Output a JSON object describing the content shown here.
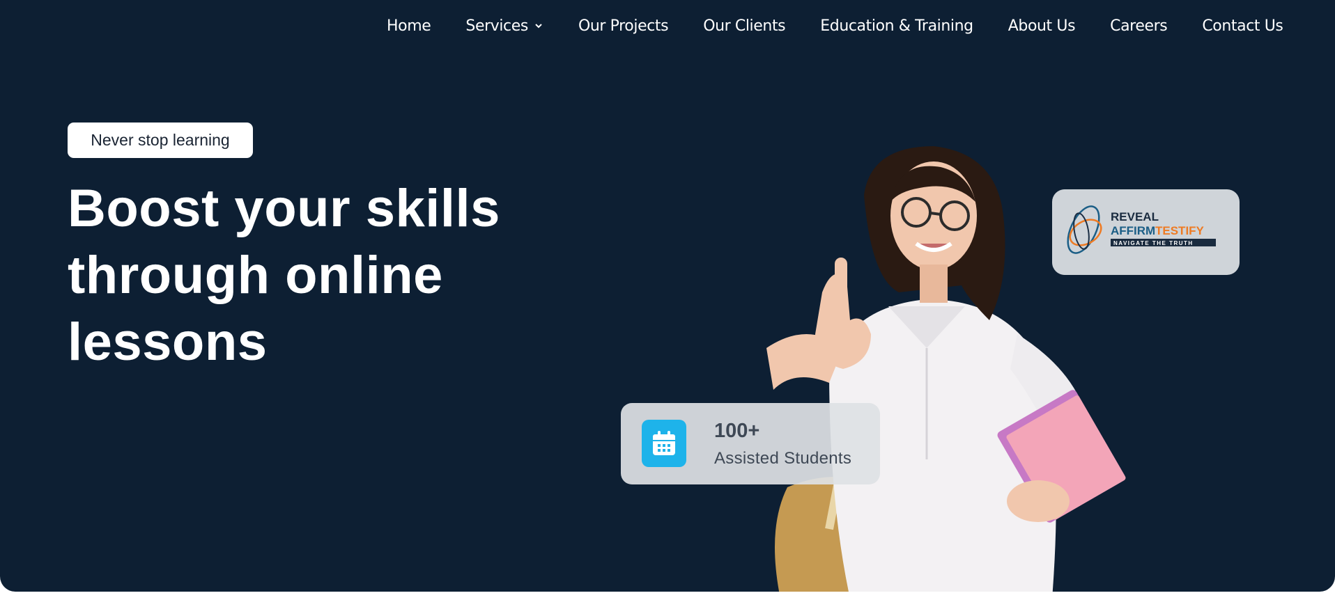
{
  "nav": {
    "items": [
      {
        "label": "Home"
      },
      {
        "label": "Services",
        "has_dropdown": true
      },
      {
        "label": "Our Projects"
      },
      {
        "label": "Our Clients"
      },
      {
        "label": "Education & Training"
      },
      {
        "label": "About Us"
      },
      {
        "label": "Careers"
      },
      {
        "label": "Contact Us"
      }
    ]
  },
  "hero": {
    "tagline": "Never stop learning",
    "headline_lines": [
      "Boost your skills",
      "through online",
      "lessons"
    ]
  },
  "logo_card": {
    "line1": "REVEAL",
    "line2a": "AFFIRM",
    "line2b": "TESTIFY",
    "line3": "NAVIGATE THE TRUTH"
  },
  "stats": {
    "value": "100+",
    "label": "Assisted Students",
    "icon": "calendar-icon"
  },
  "colors": {
    "background": "#0d1f33",
    "accent": "#1eb3ea",
    "brand_blue": "#1b5e86",
    "brand_orange": "#ee7b24"
  }
}
